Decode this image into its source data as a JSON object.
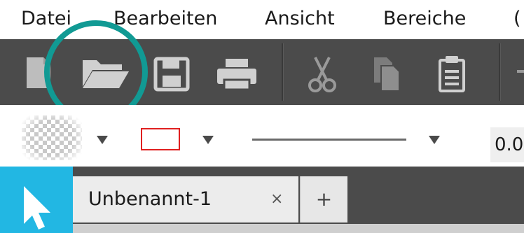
{
  "menu": {
    "items": [
      "Datei",
      "Bearbeiten",
      "Ansicht",
      "Bereiche",
      "("
    ]
  },
  "toolbar": {
    "buttons": [
      {
        "icon": "new-document-icon"
      },
      {
        "icon": "open-folder-icon",
        "highlighted": true
      },
      {
        "icon": "save-icon"
      },
      {
        "icon": "print-icon"
      },
      {
        "icon": "cut-icon"
      },
      {
        "icon": "copy-icon"
      },
      {
        "icon": "paste-icon"
      }
    ],
    "highlight_color": "#119a94"
  },
  "format": {
    "stroke_color": "#e02020",
    "width_value": "0.0"
  },
  "tabs": {
    "document_tab_label": "Unbenannt-1",
    "close_glyph": "×",
    "new_tab_glyph": "+"
  },
  "colors": {
    "toolbar_bg": "#4b4b4b",
    "select_tool": "#22b7e3"
  }
}
